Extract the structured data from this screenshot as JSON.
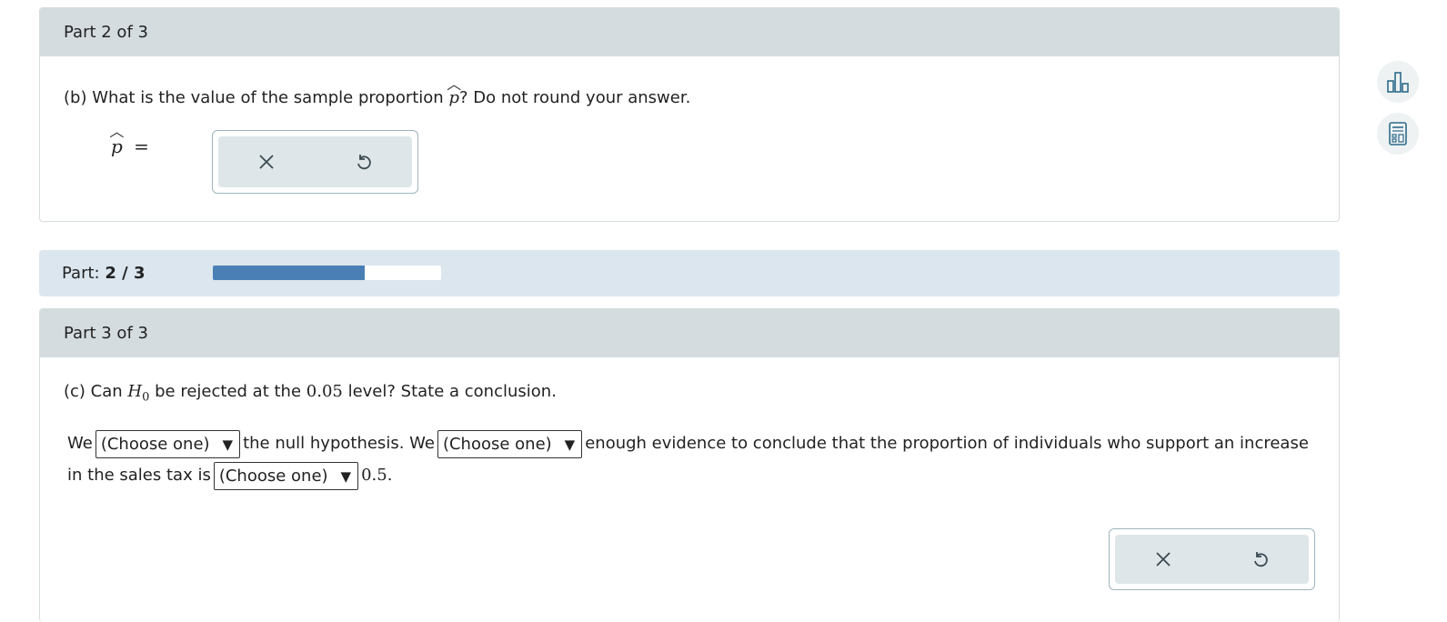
{
  "part2": {
    "header": "Part 2 of 3",
    "question_prefix": "(b) What is the value of the sample proportion",
    "question_var": "p",
    "question_suffix": "? Do not round your answer.",
    "answer_var": "p",
    "answer_eq": "=",
    "answer_value": ""
  },
  "progress": {
    "label": "Part:",
    "value": "2 / 3",
    "fraction": 0.667
  },
  "part3": {
    "header": "Part 3 of 3",
    "question_prefix": "(c) Can",
    "question_var": "H",
    "question_sub": "0",
    "question_mid": "be rejected at the",
    "question_level": "0.05",
    "question_suffix": "level? State a conclusion.",
    "s_we1": "We",
    "dropdown1": "(Choose one)",
    "s_mid1": "the null hypothesis. We",
    "dropdown2": "(Choose one)",
    "s_mid2": "enough evidence to conclude that the proportion of individuals who support an increase in the sales tax is",
    "dropdown3": "(Choose one)",
    "s_value": "0.5",
    "s_end": "."
  },
  "icons": {
    "clear": "close-icon",
    "undo": "undo-icon",
    "chart": "bar-chart-icon",
    "calculator": "calculator-icon"
  },
  "colors": {
    "accent": "#4a7fb5",
    "header_bg": "#d4dce0",
    "progress_bg": "#dbe6ef"
  }
}
